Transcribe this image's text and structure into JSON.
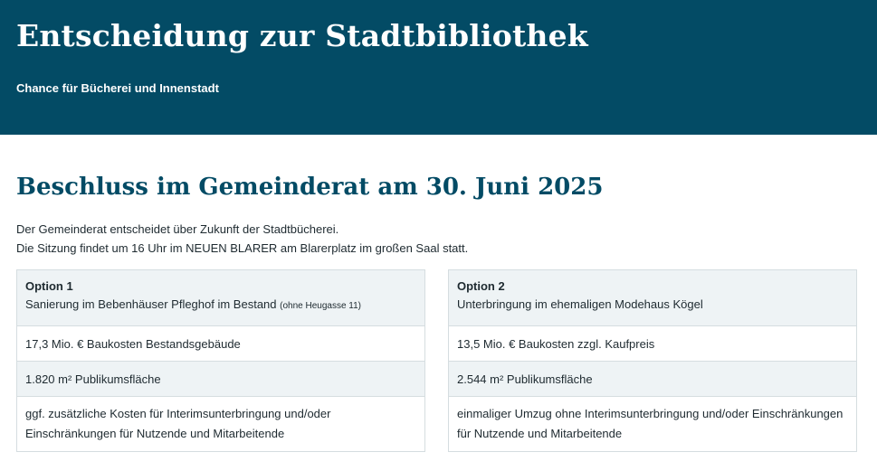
{
  "header": {
    "title": "Entscheidung zur Stadtbibliothek",
    "subtitle": "Chance für Bücherei und Innenstadt"
  },
  "main": {
    "heading": "Beschluss im Gemeinderat am 30. Juni 2025",
    "intro_line1": "Der Gemeinderat entscheidet über Zukunft der Stadtbücherei.",
    "intro_line2": "Die Sitzung findet um 16 Uhr im NEUEN BLARER am Blarerplatz im großen Saal statt."
  },
  "options": [
    {
      "label": "Option 1",
      "title": "Sanierung im Bebenhäuser Pfleghof im Bestand",
      "note": "(ohne Heugasse 11)",
      "costs": "17,3 Mio. € Baukosten Bestandsgebäude",
      "area": "1.820 m² Publikumsfläche",
      "extra": "ggf. zusätzliche Kosten für Interimsunterbringung und/oder Einschränkungen für Nutzende und Mitarbeitende"
    },
    {
      "label": "Option 2",
      "title": "Unterbringung im ehemaligen Modehaus Kögel",
      "note": "",
      "costs": "13,5 Mio. € Baukosten zzgl. Kaufpreis",
      "area": "2.544 m² Publikumsfläche",
      "extra": "einmaliger Umzug ohne Interimsunterbringung und/oder Einschränkungen für Nutzende und Mitarbeitende"
    }
  ]
}
